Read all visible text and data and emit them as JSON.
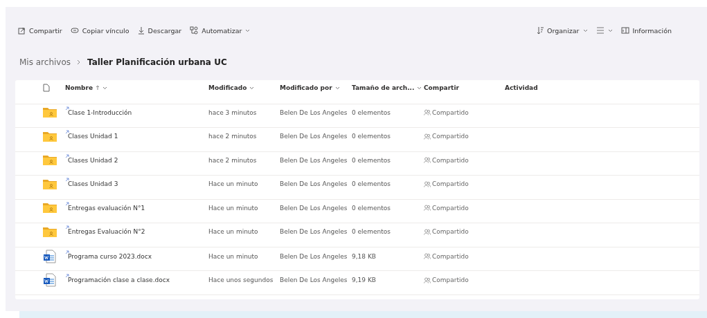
{
  "toolbar": {
    "left": [
      {
        "kind": "share",
        "label": "Compartir",
        "dropdown": false
      },
      {
        "kind": "link",
        "label": "Copiar vínculo",
        "dropdown": false
      },
      {
        "kind": "download",
        "label": "Descargar",
        "dropdown": false
      },
      {
        "kind": "flow",
        "label": "Automatizar",
        "dropdown": true
      }
    ],
    "right": [
      {
        "kind": "sort",
        "label": "Organizar",
        "dropdown": true
      },
      {
        "kind": "view",
        "dropdown": true
      },
      {
        "kind": "info",
        "label": "Información",
        "dropdown": false
      }
    ]
  },
  "breadcrumb": {
    "parent": "Mis archivos",
    "current": "Taller Planificación urbana UC"
  },
  "table": {
    "columns": [
      {
        "label": "Nombre",
        "sorted": true,
        "dropdown": true
      },
      {
        "label": "Modificado",
        "sorted": false,
        "dropdown": true
      },
      {
        "label": "Modificado por",
        "sorted": false,
        "dropdown": true
      },
      {
        "label": "Tamaño de arch...",
        "sorted": false,
        "dropdown": true
      },
      {
        "label": "Compartir",
        "sorted": false,
        "dropdown": false
      },
      {
        "label": "Actividad",
        "sorted": false,
        "dropdown": false
      }
    ],
    "rows": [
      {
        "kind": "folder",
        "name": "Clase 1-Introducción",
        "modified": "hace 3 minutos",
        "modified_by": "Belen De Los Angeles",
        "size": "0 elementos",
        "sharing": "Compartido"
      },
      {
        "kind": "folder",
        "name": "Clases Unidad 1",
        "modified": "hace 2 minutos",
        "modified_by": "Belen De Los Angeles",
        "size": "0 elementos",
        "sharing": "Compartido"
      },
      {
        "kind": "folder",
        "name": "Clases Unidad 2",
        "modified": "hace 2 minutos",
        "modified_by": "Belen De Los Angeles",
        "size": "0 elementos",
        "sharing": "Compartido"
      },
      {
        "kind": "folder",
        "name": "Clases Unidad 3",
        "modified": "Hace un minuto",
        "modified_by": "Belen De Los Angeles",
        "size": "0 elementos",
        "sharing": "Compartido"
      },
      {
        "kind": "folder",
        "name": "Entregas evaluación N°1",
        "modified": "Hace un minuto",
        "modified_by": "Belen De Los Angeles",
        "size": "0 elementos",
        "sharing": "Compartido"
      },
      {
        "kind": "folder",
        "name": "Entregas Evaluación N°2",
        "modified": "Hace un minuto",
        "modified_by": "Belen De Los Angeles",
        "size": "0 elementos",
        "sharing": "Compartido"
      },
      {
        "kind": "word",
        "name": "Programa curso 2023.docx",
        "modified": "Hace un minuto",
        "modified_by": "Belen De Los Angeles",
        "size": "9,18 KB",
        "sharing": "Compartido"
      },
      {
        "kind": "word",
        "name": "Programación clase a clase.docx",
        "modified": "Hace unos segundos",
        "modified_by": "Belen De Los Angeles",
        "size": "9,19 KB",
        "sharing": "Compartido"
      }
    ]
  }
}
